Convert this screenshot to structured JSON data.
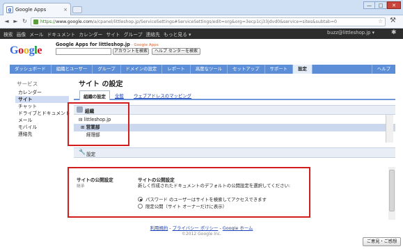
{
  "browser": {
    "tab_title": "Google Apps",
    "tab_close": "×",
    "url_proto": "https://",
    "url_host": "www.google.com",
    "url_rest": "/a/cpanel/littleshop.jp/ServiceSettings#ServiceSettings/edit=org&org=3ecp1cj33jdvd0&service=sites&subtab=0",
    "minimize": "—",
    "maximize": "□",
    "close": "✕",
    "back": "◄",
    "forward": "►",
    "reload": "↻",
    "star": "☆",
    "wrench": "⚒"
  },
  "gbar": {
    "items": [
      "検索",
      "画像",
      "メール",
      "ドキュメント",
      "カレンダー",
      "サイト",
      "グループ",
      "連絡先",
      "もっと見る ▾"
    ],
    "user": "buzz@littleshop.jp ▾",
    "gear": "✱"
  },
  "header": {
    "logo_letters": [
      {
        "ch": "G",
        "color": "#3369e8"
      },
      {
        "ch": "o",
        "color": "#d50f25"
      },
      {
        "ch": "o",
        "color": "#eeb211"
      },
      {
        "ch": "g",
        "color": "#3369e8"
      },
      {
        "ch": "l",
        "color": "#009925"
      },
      {
        "ch": "e",
        "color": "#d50f25"
      }
    ],
    "domain_title": "Google Apps for littleshop.jp",
    "domain_sub": " - Google Apps",
    "search_value": "",
    "search_button": "アカウントを検索",
    "help_button": "ヘルプ センターを検索"
  },
  "mainnav": {
    "items": [
      "ダッシュボード",
      "組織とユーザー",
      "グループ",
      "ドメインの設定",
      "レポート",
      "高度なツール",
      "セットアップ",
      "サポート",
      "設定"
    ],
    "active": "設定",
    "help": "ヘルプ"
  },
  "sidebar": {
    "header": "サービス",
    "items": [
      "カレンダー",
      "サイト",
      "チャット",
      "ドライブとドキュメント",
      "メール",
      "モバイル",
      "連絡先"
    ],
    "active": "サイト"
  },
  "main": {
    "title": "サイト の設定",
    "subtabs": {
      "org": "組織の設定",
      "all": "全般",
      "url": "ウェブアドレスのマッピング"
    },
    "org": {
      "header": "組織",
      "root": "littleshop.jp",
      "root_toggle": "⊟",
      "sales": "営業部",
      "sales_toggle": "⊞",
      "accounting": "経理部"
    },
    "settings_header": "設定",
    "publish": {
      "label": "サイトの公開設定",
      "inherit": "継承",
      "title": "サイトの公開設定",
      "desc": "新しく作成されたドキュメントのデフォルトの公開設定を選択してください:",
      "options": [
        {
          "label": "パスワード のユーザーはサイトを検索してアクセスできます",
          "selected": true
        },
        {
          "label": "限定公開（サイト オーナーだけに表示）",
          "selected": false
        }
      ]
    }
  },
  "footer": {
    "links": [
      "利用規約",
      "プライバシー ポリシー",
      "Google ホーム"
    ],
    "separator": " - ",
    "copyright": "©2012 Google Inc.",
    "feedback": "ご意見・ご感想"
  }
}
